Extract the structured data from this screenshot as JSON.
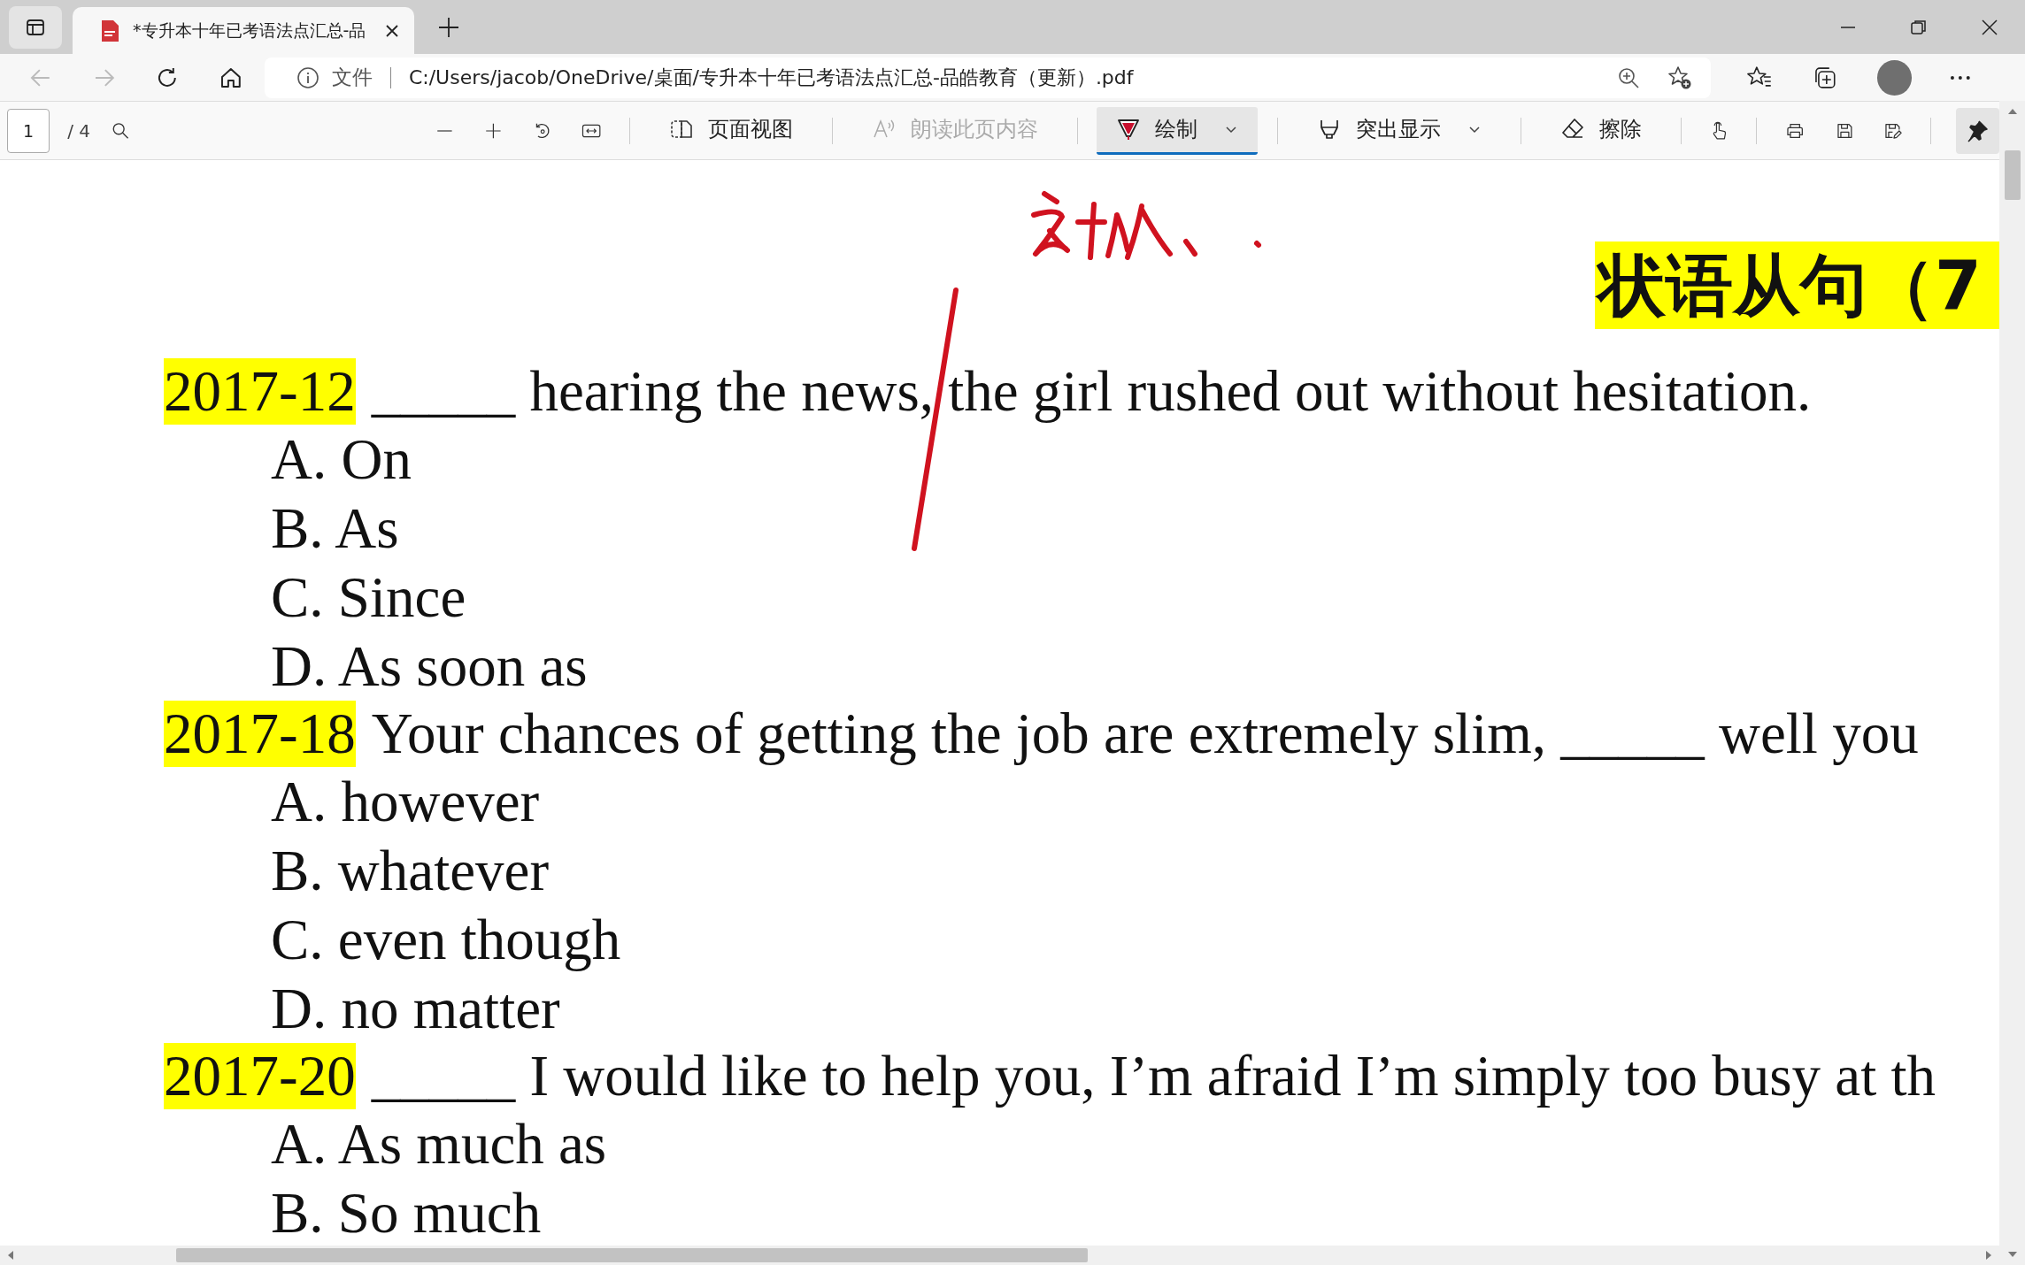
{
  "tabs": [
    {
      "title": "*专升本十年已考语法点汇总-品",
      "selected": true
    }
  ],
  "address_bar": {
    "security_label": "文件",
    "url": "C:/Users/jacob/OneDrive/桌面/专升本十年已考语法点汇总-品皓教育（更新）.pdf"
  },
  "pdf_toolbar": {
    "page": "1",
    "page_count": "/ 4",
    "tools": [
      {
        "kind": "view",
        "label": "页面视图",
        "disabled": false,
        "selected": false,
        "dropdown": false
      },
      {
        "kind": "read",
        "label": "朗读此页内容",
        "disabled": true,
        "selected": false,
        "dropdown": false
      },
      {
        "kind": "draw",
        "label": "绘制",
        "disabled": false,
        "selected": true,
        "dropdown": true
      },
      {
        "kind": "highlight",
        "label": "突出显示",
        "disabled": false,
        "selected": false,
        "dropdown": true
      },
      {
        "kind": "erase",
        "label": "擦除",
        "disabled": false,
        "selected": false,
        "dropdown": false
      }
    ],
    "pinned": true
  },
  "document": {
    "title": "状语从句（7",
    "questions": [
      {
        "year": "2017-12",
        "stem": "_____ hearing the news, the girl rushed out without hesitation.",
        "options": [
          "A. On",
          "B. As",
          "C. Since",
          "D. As soon as"
        ]
      },
      {
        "year": "2017-18",
        "stem": "Your chances of getting the job are extremely slim, _____ well you",
        "options": [
          "A. however",
          "B. whatever",
          "C. even though",
          "D. no matter"
        ]
      },
      {
        "year": "2017-20",
        "stem": "_____ I would like to help you, I’m afraid I’m simply too busy at th",
        "options": [
          "A. As much as",
          "B. So much"
        ]
      }
    ]
  }
}
